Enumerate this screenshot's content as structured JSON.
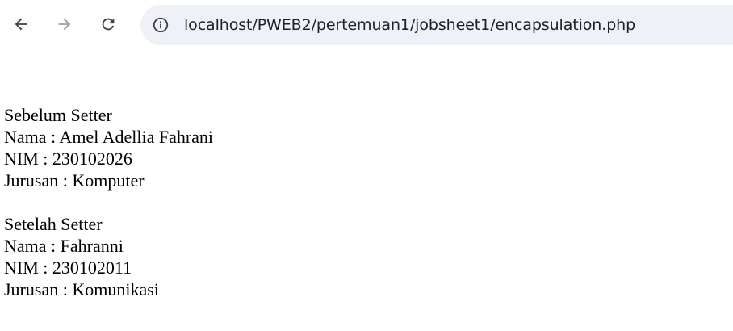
{
  "browser": {
    "url": "localhost/PWEB2/pertemuan1/jobsheet1/encapsulation.php",
    "icons": {
      "back": "arrow-back-icon",
      "forward": "arrow-forward-icon",
      "reload": "reload-icon",
      "site_info": "info-circle-icon"
    },
    "colors": {
      "omnibox_bg": "#eef1f8",
      "icon_active": "#3c4043",
      "icon_disabled": "#9aa0a6"
    }
  },
  "page": {
    "before": {
      "heading": "Sebelum Setter",
      "nama": "Nama : Amel Adellia Fahrani",
      "nim": "NIM : 230102026",
      "jurusan": "Jurusan : Komputer"
    },
    "after": {
      "heading": "Setelah Setter",
      "nama": "Nama : Fahranni",
      "nim": "NIM : 230102011",
      "jurusan": "Jurusan : Komunikasi"
    }
  }
}
